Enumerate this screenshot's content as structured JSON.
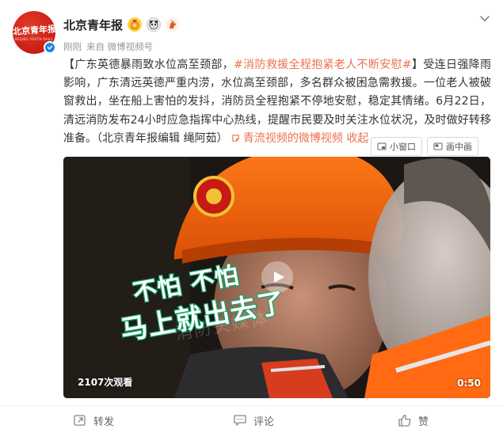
{
  "author": {
    "avatar_text": "北京青年报",
    "avatar_subtext": "BEIJING YOUTH DAILY",
    "name": "北京青年报",
    "badges": [
      "gold-medal-icon",
      "panda-badge-icon",
      "horse-badge-icon"
    ],
    "time": "刚刚",
    "source": "来自 微博视频号"
  },
  "post": {
    "text_lead": "【广东英德暴雨致水位高至颈部，",
    "hashtag": "#消防救援全程抱紧老人不断安慰#",
    "text_body": "】受连日强降雨影响，广东清远英德严重内涝，水位高至颈部，多名群众被困急需救援。一位老人被破窗救出，坐在船上害怕的发抖，消防员全程抱紧不停地安慰，稳定其情绪。6月22日，清远消防发布24小时应急指挥中心热线，提醒市民要及时关注水位状况，及时做好转移准备。（北京青年报编辑 绳阿茹）",
    "link_text": "青流视频的微博视频",
    "collapse_text": "收起",
    "link_color": "#eb7350"
  },
  "video_tools": {
    "small_window": "小窗口",
    "picture_in_picture": "画中画"
  },
  "video": {
    "caption_line1": "不怕 不怕",
    "caption_line2": "马上就出去了",
    "watermark": "消防头媒体",
    "views": "2107次观看",
    "duration": "0:50",
    "caption_color": "#12a36b"
  },
  "actions": {
    "forward": "转发",
    "comment": "评论",
    "like": "赞"
  }
}
